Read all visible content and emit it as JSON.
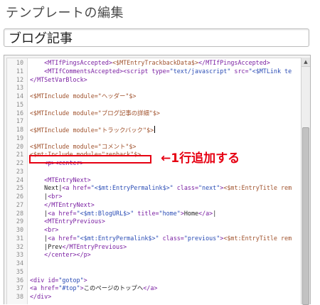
{
  "page": {
    "heading": "テンプレートの編集"
  },
  "template_name": {
    "value": "ブログ記事"
  },
  "annotation": {
    "text": "←1行追加する",
    "color": "#e60012",
    "highlighted_line": 21
  },
  "editor": {
    "caret_line": 18,
    "lines": [
      {
        "n": "10",
        "tokens": [
          {
            "t": "    <MTIfPingsAccepted>",
            "c": "tag"
          },
          {
            "t": "<$MTEntryTrackbackData$>",
            "c": "mt"
          },
          {
            "t": "</MTIfPingsAccepted>",
            "c": "tag"
          }
        ]
      },
      {
        "n": "11",
        "tokens": [
          {
            "t": "    <MTIfCommentsAccepted>",
            "c": "tag"
          },
          {
            "t": "<script ",
            "c": "tag"
          },
          {
            "t": "type=",
            "c": "tag"
          },
          {
            "t": "\"text/javascript\"",
            "c": "str"
          },
          {
            "t": " src=",
            "c": "tag"
          },
          {
            "t": "\"<$MTLink te",
            "c": "str"
          }
        ]
      },
      {
        "n": "12",
        "tokens": [
          {
            "t": "</MTSetVarBlock>",
            "c": "tag"
          }
        ]
      },
      {
        "n": "13",
        "tokens": []
      },
      {
        "n": "14",
        "tokens": [
          {
            "t": "<$MTInclude module=\"ヘッダー\"$>",
            "c": "mt"
          }
        ]
      },
      {
        "n": "15",
        "tokens": []
      },
      {
        "n": "16",
        "tokens": [
          {
            "t": "<$MTInclude module=\"ブログ記事の詳細\"$>",
            "c": "mt"
          }
        ]
      },
      {
        "n": "17",
        "tokens": []
      },
      {
        "n": "18",
        "tokens": [
          {
            "t": "<$MTInclude module=\"トラックバック\"$>",
            "c": "mt"
          }
        ]
      },
      {
        "n": "19",
        "tokens": []
      },
      {
        "n": "20",
        "tokens": [
          {
            "t": "<$MTInclude module=\"コメント\"$>",
            "c": "mt"
          }
        ]
      },
      {
        "n": "21",
        "tokens": [
          {
            "t": "<$mt:Include module=\"zenback\"$>",
            "c": "mt"
          }
        ]
      },
      {
        "n": "22",
        "tokens": [
          {
            "t": "    <p><center>",
            "c": "tag"
          }
        ]
      },
      {
        "n": "23",
        "tokens": []
      },
      {
        "n": "24",
        "tokens": [
          {
            "t": "    <MTEntryNext>",
            "c": "tag"
          }
        ]
      },
      {
        "n": "25",
        "tokens": [
          {
            "t": "    Next|",
            "c": "plain"
          },
          {
            "t": "<a href=",
            "c": "tag"
          },
          {
            "t": "\"<$mt:EntryPermalink$>\"",
            "c": "str"
          },
          {
            "t": " class=",
            "c": "tag"
          },
          {
            "t": "\"next\"",
            "c": "str"
          },
          {
            "t": ">",
            "c": "tag"
          },
          {
            "t": "<$mt:EntryTitle rem",
            "c": "mt"
          }
        ]
      },
      {
        "n": "26",
        "tokens": [
          {
            "t": "    |",
            "c": "plain"
          },
          {
            "t": "<br>",
            "c": "tag"
          }
        ]
      },
      {
        "n": "27",
        "tokens": [
          {
            "t": "    </MTEntryNext>",
            "c": "tag"
          }
        ]
      },
      {
        "n": "28",
        "tokens": [
          {
            "t": "    |",
            "c": "plain"
          },
          {
            "t": "<a href=",
            "c": "tag"
          },
          {
            "t": "\"<$mt:BlogURL$>\"",
            "c": "str"
          },
          {
            "t": " title=",
            "c": "tag"
          },
          {
            "t": "\"home\"",
            "c": "str"
          },
          {
            "t": ">",
            "c": "tag"
          },
          {
            "t": "Home",
            "c": "plain"
          },
          {
            "t": "</a>",
            "c": "tag"
          },
          {
            "t": "|",
            "c": "plain"
          }
        ]
      },
      {
        "n": "29",
        "tokens": [
          {
            "t": "    <MTEntryPrevious>",
            "c": "tag"
          }
        ]
      },
      {
        "n": "30",
        "tokens": [
          {
            "t": "    <br>",
            "c": "tag"
          }
        ]
      },
      {
        "n": "31",
        "tokens": [
          {
            "t": "    |",
            "c": "plain"
          },
          {
            "t": "<a href=",
            "c": "tag"
          },
          {
            "t": "\"<$mt:EntryPermalink$>\"",
            "c": "str"
          },
          {
            "t": " class=",
            "c": "tag"
          },
          {
            "t": "\"previous\"",
            "c": "str"
          },
          {
            "t": ">",
            "c": "tag"
          },
          {
            "t": "<$mt:EntryTitle rem",
            "c": "mt"
          }
        ]
      },
      {
        "n": "32",
        "tokens": [
          {
            "t": "    |Prev",
            "c": "plain"
          },
          {
            "t": "</MTEntryPrevious>",
            "c": "tag"
          }
        ]
      },
      {
        "n": "33",
        "tokens": [
          {
            "t": "    </center></p>",
            "c": "tag"
          }
        ]
      },
      {
        "n": "34",
        "tokens": []
      },
      {
        "n": "35",
        "tokens": []
      },
      {
        "n": "36",
        "tokens": [
          {
            "t": "<div id=",
            "c": "tag"
          },
          {
            "t": "\"gotop\"",
            "c": "str"
          },
          {
            "t": ">",
            "c": "tag"
          }
        ]
      },
      {
        "n": "37",
        "tokens": [
          {
            "t": "<a href=",
            "c": "tag"
          },
          {
            "t": "\"#top\"",
            "c": "str"
          },
          {
            "t": ">",
            "c": "tag"
          },
          {
            "t": "このページのトップへ",
            "c": "plain"
          },
          {
            "t": "</a>",
            "c": "tag"
          }
        ]
      },
      {
        "n": "38",
        "tokens": [
          {
            "t": "</div>",
            "c": "tag"
          }
        ]
      }
    ]
  }
}
